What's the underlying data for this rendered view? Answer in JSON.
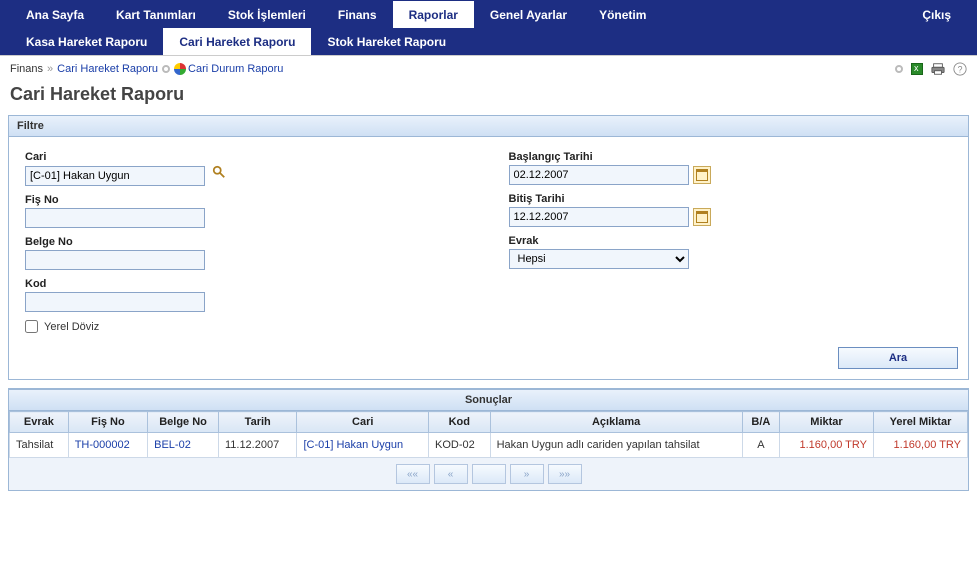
{
  "topnav": {
    "items": [
      {
        "label": "Ana Sayfa"
      },
      {
        "label": "Kart Tanımları"
      },
      {
        "label": "Stok İşlemleri"
      },
      {
        "label": "Finans"
      },
      {
        "label": "Raporlar"
      },
      {
        "label": "Genel Ayarlar"
      },
      {
        "label": "Yönetim"
      }
    ],
    "exit_label": "Çıkış",
    "active_index": 4
  },
  "subnav": {
    "items": [
      {
        "label": "Kasa Hareket Raporu"
      },
      {
        "label": "Cari Hareket Raporu"
      },
      {
        "label": "Stok Hareket Raporu"
      }
    ],
    "active_index": 1
  },
  "breadcrumb": {
    "parts": [
      {
        "text": "Finans",
        "link": false
      },
      {
        "text": "Cari Hareket Raporu",
        "link": true
      },
      {
        "text": "Cari Durum Raporu",
        "link": true
      }
    ],
    "sep": "»"
  },
  "page_title": "Cari Hareket Raporu",
  "filter": {
    "header": "Filtre",
    "cari_label": "Cari",
    "cari_value": "[C-01] Hakan Uygun",
    "fis_no_label": "Fiş No",
    "fis_no_value": "",
    "belge_no_label": "Belge No",
    "belge_no_value": "",
    "kod_label": "Kod",
    "kod_value": "",
    "yerel_doviz_label": "Yerel Döviz",
    "baslangic_label": "Başlangıç Tarihi",
    "baslangic_value": "02.12.2007",
    "bitis_label": "Bitiş Tarihi",
    "bitis_value": "12.12.2007",
    "evrak_label": "Evrak",
    "evrak_value": "Hepsi",
    "search_label": "Ara"
  },
  "results": {
    "header": "Sonuçlar",
    "columns": [
      "Evrak",
      "Fiş No",
      "Belge No",
      "Tarih",
      "Cari",
      "Kod",
      "Açıklama",
      "B/A",
      "Miktar",
      "Yerel Miktar"
    ],
    "rows": [
      {
        "evrak": "Tahsilat",
        "fis_no": "TH-000002",
        "belge_no": "BEL-02",
        "tarih": "11.12.2007",
        "cari": "[C-01] Hakan Uygun",
        "kod": "KOD-02",
        "aciklama": "Hakan Uygun adlı cariden yapılan tahsilat",
        "ba": "A",
        "miktar": "1.160,00 TRY",
        "yerel_miktar": "1.160,00 TRY"
      }
    ]
  },
  "pager": {
    "first": "««",
    "prev": "«",
    "sep": "",
    "next": "»",
    "last": "»»"
  }
}
